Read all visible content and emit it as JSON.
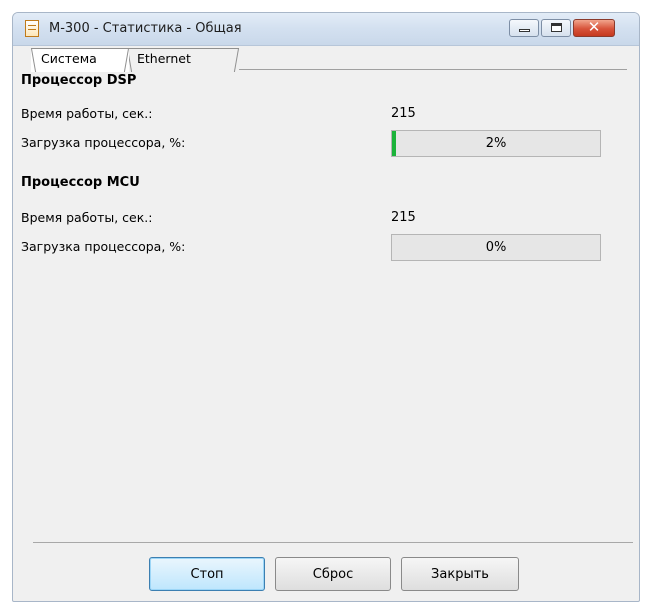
{
  "window": {
    "title": "М-300 - Статистика - Общая"
  },
  "tabs": [
    {
      "label": "Система",
      "active": true
    },
    {
      "label": "Ethernet",
      "active": false
    }
  ],
  "dsp": {
    "title": "Процессор DSP",
    "uptime_label": "Время работы, сек.:",
    "uptime_value": "215",
    "load_label": "Загрузка процессора, %:",
    "load_text": "2%",
    "load_fraction": 0.02
  },
  "mcu": {
    "title": "Процессор MCU",
    "uptime_label": "Время работы, сек.:",
    "uptime_value": "215",
    "load_label": "Загрузка процессора, %:",
    "load_text": "0%",
    "load_fraction": 0.0
  },
  "buttons": {
    "stop": "Стоп",
    "reset": "Сброс",
    "close": "Закрыть"
  },
  "colors": {
    "progress_fill": "#1bb33a",
    "close_button": "#c5391f"
  },
  "icons": {
    "app": "notepad-icon",
    "minimize": "minimize-icon",
    "maximize": "maximize-icon",
    "close": "close-icon"
  }
}
